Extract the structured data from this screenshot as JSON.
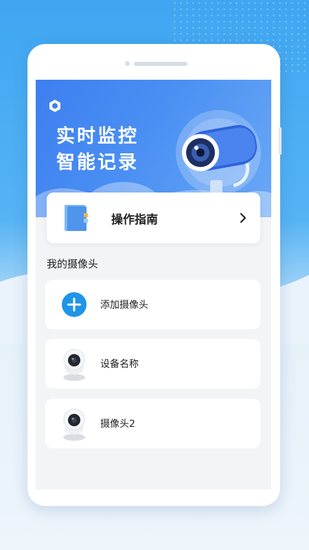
{
  "banner": {
    "headline_line1": "实时监控",
    "headline_line2": "智能记录",
    "logo_icon": "app-logo-icon",
    "illustration": "security-camera-icon"
  },
  "guide": {
    "label": "操作指南",
    "icon": "document-icon",
    "arrow": "chevron-right-icon"
  },
  "section": {
    "title": "我的摄像头"
  },
  "cameras": [
    {
      "label": "添加摄像头",
      "icon": "add-icon"
    },
    {
      "label": "设备名称",
      "icon": "camera-device-icon"
    },
    {
      "label": "摄像头2",
      "icon": "camera-device-icon"
    }
  ],
  "colors": {
    "accent": "#1f95e8",
    "banner_start": "#3d7ff0",
    "background_top": "#3fa6f2"
  }
}
